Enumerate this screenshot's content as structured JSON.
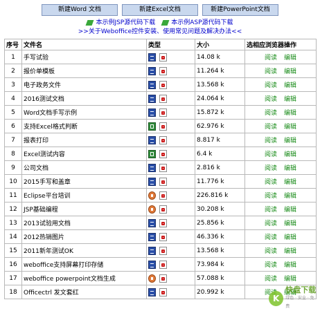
{
  "toolbar": {
    "new_word": "新建Word 文档",
    "new_excel": "新建Excel文档",
    "new_ppt": "新建PowerPoint文档"
  },
  "downloads": {
    "jsp": "本示例JSP源代码下载",
    "asp": "本示例ASP源代码下载"
  },
  "help_link": ">>关于Weboffice控件安装、使用常见问题及解决办法<<",
  "table": {
    "headers": {
      "no": "序号",
      "name": "文件名",
      "type": "类型",
      "size": "大小",
      "op": "选相应浏览器操作"
    },
    "op_read": "阅读",
    "op_edit": "编辑",
    "rows": [
      {
        "no": "1",
        "name": "手写试验",
        "icon": "word",
        "size": "14.08 k"
      },
      {
        "no": "2",
        "name": "报价单模板",
        "icon": "word",
        "size": "11.264 k"
      },
      {
        "no": "3",
        "name": "电子政务文件",
        "icon": "word",
        "size": "13.568 k"
      },
      {
        "no": "4",
        "name": "2016测试文档",
        "icon": "word",
        "size": "24.064 k"
      },
      {
        "no": "5",
        "name": "Word文档手写示例",
        "icon": "word",
        "size": "15.872 k"
      },
      {
        "no": "6",
        "name": "支持Excel格式判断",
        "icon": "excel",
        "size": "62.976 k"
      },
      {
        "no": "7",
        "name": "报表打印",
        "icon": "word",
        "size": "8.817 k"
      },
      {
        "no": "8",
        "name": "Excel测试内容",
        "icon": "excel",
        "size": "6.4 k"
      },
      {
        "no": "9",
        "name": "公司文档",
        "icon": "word",
        "size": "2.816 k"
      },
      {
        "no": "10",
        "name": "2015手写和盖章",
        "icon": "word",
        "size": "11.776 k"
      },
      {
        "no": "11",
        "name": "Eclipse平台培训",
        "icon": "ppt",
        "size": "226.816 k"
      },
      {
        "no": "12",
        "name": "JSP基础编程",
        "icon": "ppt",
        "size": "30.208 k"
      },
      {
        "no": "13",
        "name": "2013试验用文档",
        "icon": "word",
        "size": "25.856 k"
      },
      {
        "no": "14",
        "name": "2012热销图片",
        "icon": "word",
        "size": "46.336 k"
      },
      {
        "no": "15",
        "name": "2011新年测试OK",
        "icon": "word",
        "size": "13.568 k"
      },
      {
        "no": "16",
        "name": "weboffice支持屏幕打印存储",
        "icon": "word",
        "size": "73.984 k"
      },
      {
        "no": "17",
        "name": "weboffice powerpoint文档生成",
        "icon": "ppt",
        "size": "57.088 k"
      },
      {
        "no": "18",
        "name": "Officectrl 发文套红",
        "icon": "word",
        "size": "20.992 k"
      }
    ]
  },
  "watermark": {
    "mark": "K",
    "brand": "快盘下载",
    "slogan": "绿色 · 安全 · 免费"
  }
}
